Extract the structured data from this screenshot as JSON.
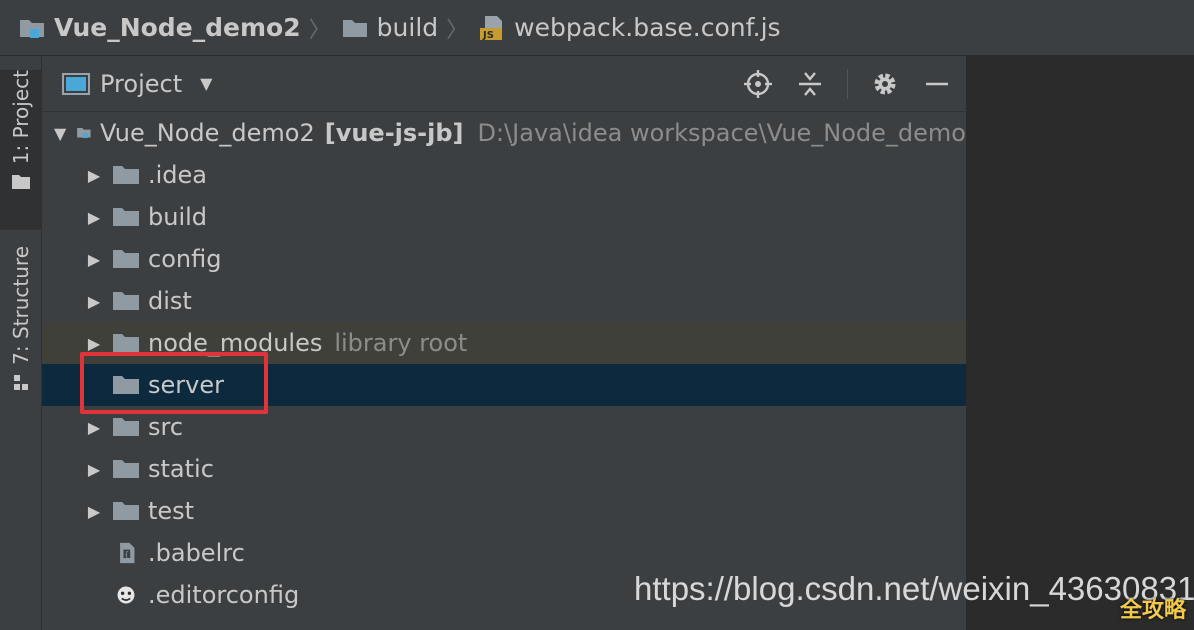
{
  "breadcrumb": {
    "items": [
      {
        "label": "Vue_Node_demo2",
        "icon": "module-icon"
      },
      {
        "label": "build",
        "icon": "folder-icon"
      },
      {
        "label": "webpack.base.conf.js",
        "icon": "js-file-icon"
      }
    ]
  },
  "stripe": {
    "project_label": "1: Project",
    "structure_label": "7: Structure"
  },
  "panel": {
    "title": "Project",
    "tools": {
      "locate": "crosshair-icon",
      "collapse": "collapse-all-icon",
      "settings": "gear-icon",
      "hide": "minimize-icon"
    }
  },
  "tree": {
    "root": {
      "name": "Vue_Node_demo2",
      "module": "[vue-js-jb]",
      "path": "D:\\Java\\idea workspace\\Vue_Node_demo"
    },
    "items": [
      {
        "label": ".idea",
        "type": "folder",
        "expandable": true
      },
      {
        "label": "build",
        "type": "folder",
        "expandable": true
      },
      {
        "label": "config",
        "type": "folder",
        "expandable": true
      },
      {
        "label": "dist",
        "type": "folder",
        "expandable": true
      },
      {
        "label": "node_modules",
        "type": "folder",
        "expandable": true,
        "hint": "library root"
      },
      {
        "label": "server",
        "type": "folder",
        "expandable": false,
        "selected": true
      },
      {
        "label": "src",
        "type": "folder",
        "expandable": true
      },
      {
        "label": "static",
        "type": "folder",
        "expandable": true
      },
      {
        "label": "test",
        "type": "folder",
        "expandable": true
      },
      {
        "label": ".babelrc",
        "type": "file",
        "expandable": false
      },
      {
        "label": ".editorconfig",
        "type": "file",
        "expandable": false
      }
    ]
  },
  "watermark": "https://blog.csdn.net/weixin_43630831",
  "corner_logo": "全攻略",
  "colors": {
    "selection": "#0d293e",
    "highlight_box": "#e0343a",
    "folder": "#8f9aa3"
  }
}
